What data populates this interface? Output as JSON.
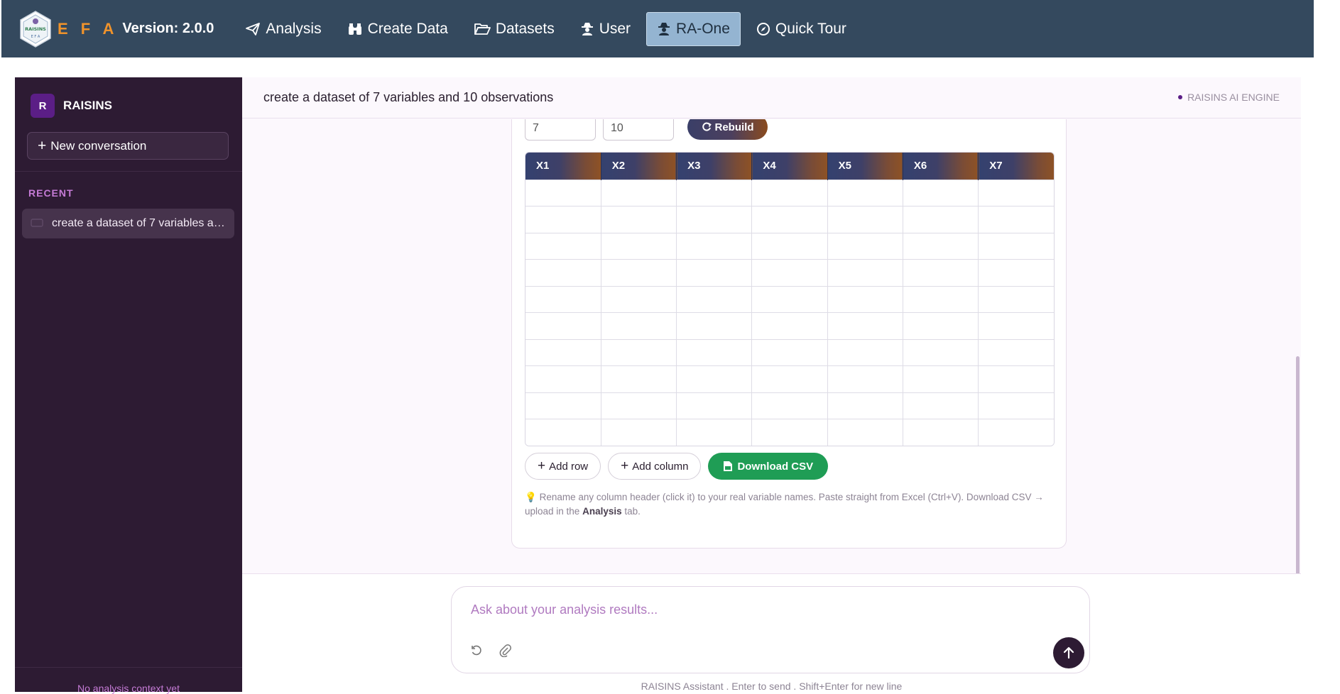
{
  "navbar": {
    "brand_name": "E F A",
    "version": "Version: 2.0.0",
    "logo_text": "RAISINS",
    "items": [
      {
        "label": "Analysis",
        "icon": "paper-plane-icon"
      },
      {
        "label": "Create Data",
        "icon": "binoculars-icon"
      },
      {
        "label": "Datasets",
        "icon": "folder-open-icon"
      },
      {
        "label": "User",
        "icon": "user-secret-icon"
      },
      {
        "label": "RA-One",
        "icon": "user-secret-icon",
        "active": true
      },
      {
        "label": "Quick Tour",
        "icon": "compass-icon"
      }
    ],
    "colors": {
      "background": "#34495e",
      "brand": "#f0932b",
      "active": "#94b4d1"
    }
  },
  "sidebar": {
    "avatar": "R",
    "title": "RAISINS",
    "new_conversation": "New conversation",
    "recent_label": "RECENT",
    "conversations": [
      {
        "title": "create a dataset of 7 variables and 10 observations"
      }
    ],
    "footer": "No analysis context yet",
    "colors": {
      "background": "#2d1b33",
      "accent": "#c57bd6"
    }
  },
  "main": {
    "title": "create a dataset of 7 variables and 10 observations",
    "engine_label": "RAISINS AI ENGINE"
  },
  "builder": {
    "variables_value": "7",
    "observations_value": "10",
    "rebuild_label": "Rebuild",
    "columns": [
      "X1",
      "X2",
      "X3",
      "X4",
      "X5",
      "X6",
      "X7"
    ],
    "row_count": 10,
    "add_row_label": "Add row",
    "add_column_label": "Add column",
    "download_label": "Download CSV",
    "tip_part1": "Rename any column header (click it) to your real variable names. Paste straight from Excel (Ctrl+V). Download CSV → upload in the ",
    "tip_bold": "Analysis",
    "tip_part2": " tab.",
    "colors": {
      "download": "#1f9d55"
    }
  },
  "composer": {
    "placeholder": "Ask about your analysis results...",
    "hint": "RAISINS Assistant . Enter to send . Shift+Enter for new line"
  }
}
